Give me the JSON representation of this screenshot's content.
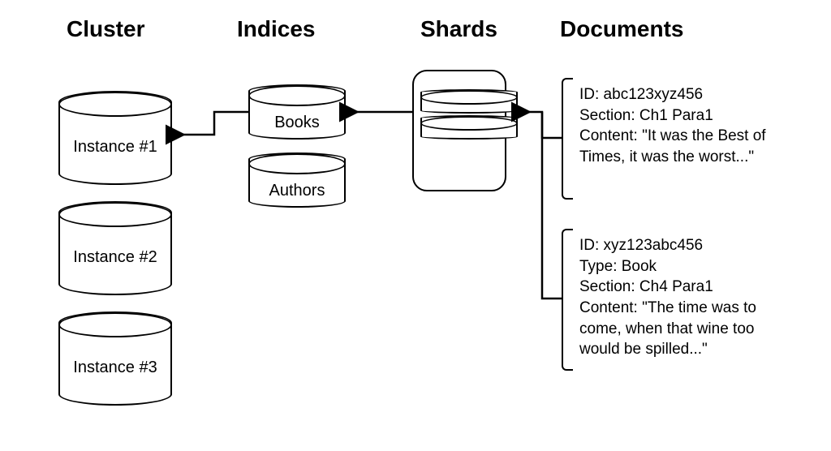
{
  "headings": {
    "cluster": "Cluster",
    "indices": "Indices",
    "shards": "Shards",
    "documents": "Documents"
  },
  "cluster": {
    "instances": [
      "Instance #1",
      "Instance #2",
      "Instance #3"
    ]
  },
  "indices": {
    "items": [
      "Books",
      "Authors"
    ]
  },
  "documents": [
    {
      "id_line": "ID: abc123xyz456",
      "section_line": "Section: Ch1 Para1",
      "content_line": "Content: \"It was the Best of Times, it was the worst...\""
    },
    {
      "id_line": "ID: xyz123abc456",
      "type_line": "Type: Book",
      "section_line": "Section: Ch4 Para1",
      "content_line": "Content: \"The time was to come, when that wine too would be spilled...\""
    }
  ]
}
